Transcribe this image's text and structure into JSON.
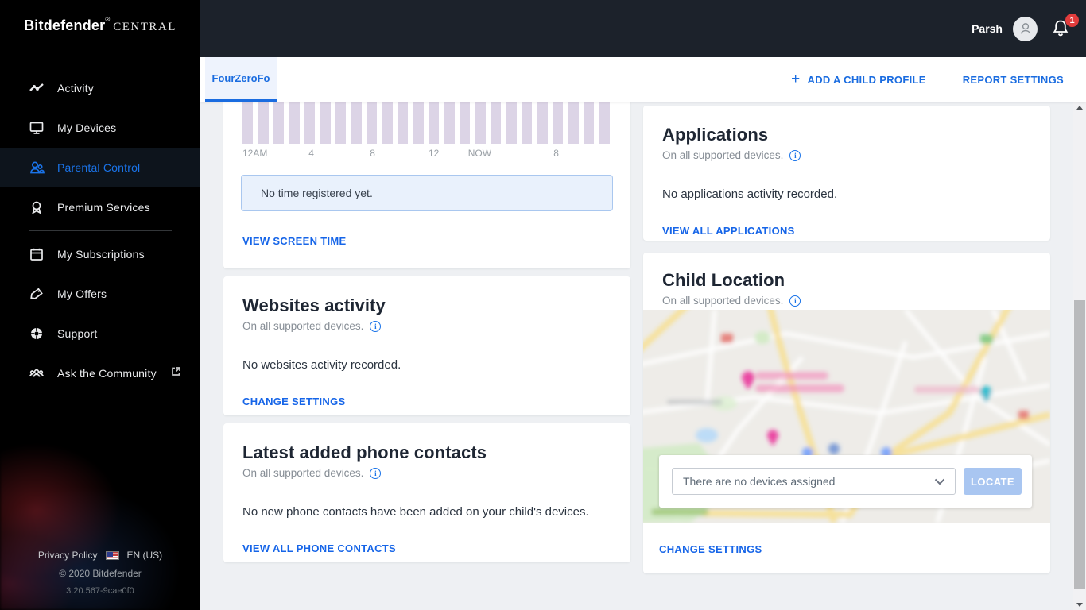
{
  "app": {
    "brand": "Bitdefender",
    "registered": "®",
    "suffix": "CENTRAL"
  },
  "topbar": {
    "username": "Parsh",
    "notification_count": "1"
  },
  "sidebar": {
    "items": [
      {
        "label": "Activity"
      },
      {
        "label": "My Devices"
      },
      {
        "label": "Parental Control"
      },
      {
        "label": "Premium Services"
      },
      {
        "label": "My Subscriptions"
      },
      {
        "label": "My Offers"
      },
      {
        "label": "Support"
      },
      {
        "label": "Ask the Community"
      }
    ],
    "footer": {
      "privacy_policy": "Privacy Policy",
      "language": "EN (US)",
      "copyright": "© 2020 Bitdefender",
      "version": "3.20.567-9cae0f0"
    }
  },
  "header": {
    "tab": "FourZeroFo",
    "add_child_profile": "ADD A CHILD PROFILE",
    "report_settings": "REPORT SETTINGS"
  },
  "cards": {
    "screen_time": {
      "empty_message": "No time registered yet.",
      "link": "VIEW SCREEN TIME"
    },
    "websites": {
      "title": "Websites activity",
      "subtitle": "On all supported devices.",
      "body": "No websites activity recorded.",
      "link": "CHANGE SETTINGS"
    },
    "contacts": {
      "title": "Latest added phone contacts",
      "subtitle": "On all supported devices.",
      "body": "No new phone contacts have been added on your child's devices.",
      "link": "VIEW ALL PHONE CONTACTS"
    },
    "applications": {
      "title": "Applications",
      "subtitle": "On all supported devices.",
      "body": "No applications activity recorded.",
      "link": "VIEW ALL APPLICATIONS"
    },
    "location": {
      "title": "Child Location",
      "subtitle": "On all supported devices.",
      "select_value": "There are no devices assigned",
      "locate_label": "LOCATE",
      "link": "CHANGE SETTINGS"
    }
  },
  "chart_data": {
    "type": "bar",
    "placeholder": true,
    "note": "Hourly screen-time chart; uniform placeholder bars because no time has been registered yet",
    "bar_count": 24,
    "values": [
      1,
      1,
      1,
      1,
      1,
      1,
      1,
      1,
      1,
      1,
      1,
      1,
      1,
      1,
      1,
      1,
      1,
      1,
      1,
      1,
      1,
      1,
      1,
      1
    ],
    "x_ticks": [
      {
        "label": "12AM",
        "bar": 0
      },
      {
        "label": "4",
        "bar": 4
      },
      {
        "label": "8",
        "bar": 8
      },
      {
        "label": "12",
        "bar": 12
      },
      {
        "label": "NOW",
        "bar": 15
      },
      {
        "label": "8",
        "bar": 20
      }
    ],
    "bar_color": "#dcd4e6"
  },
  "colors": {
    "accent_blue": "#1a6ce0",
    "link_blue": "#1665e8",
    "badge_red": "#e23c3c",
    "bar_lavender": "#dcd4e6",
    "locate_disabled": "#a9c6f1",
    "topbar_dark": "#1c222b"
  }
}
